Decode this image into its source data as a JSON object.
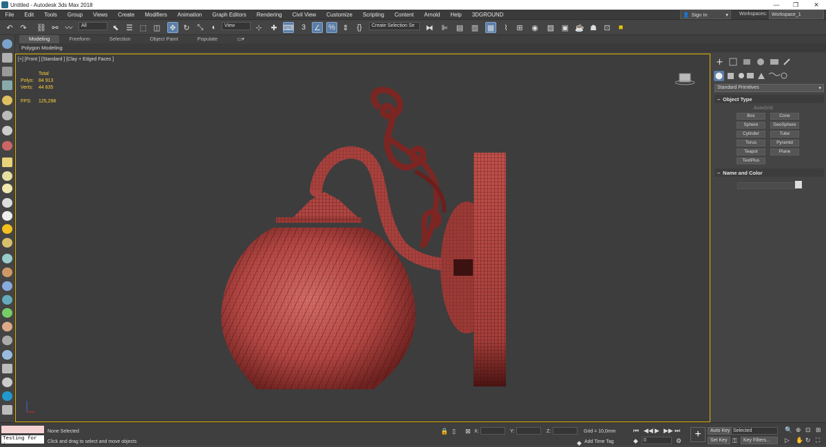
{
  "window": {
    "title": "Untitled - Autodesk 3ds Max 2018"
  },
  "menu": [
    "File",
    "Edit",
    "Tools",
    "Group",
    "Views",
    "Create",
    "Modifiers",
    "Animation",
    "Graph Editors",
    "Rendering",
    "Civil View",
    "Customize",
    "Scripting",
    "Content",
    "Arnold",
    "Help",
    "3DGROUND"
  ],
  "account": {
    "sign_in": "Sign In",
    "workspaces_label": "Workspaces:",
    "workspace": "Workspace_1"
  },
  "toolbar": {
    "filter": "All",
    "refcoord": "View",
    "selection_set": "Create Selection Se"
  },
  "ribbon": {
    "tabs": [
      "Modeling",
      "Freeform",
      "Selection",
      "Object Paint",
      "Populate"
    ],
    "active": "Modeling",
    "sub": "Polygon Modeling"
  },
  "viewport": {
    "label": "[+] [Front ] [Standard ] [Clay + Edged Faces ]",
    "stats": {
      "header": "Total",
      "polys_label": "Polys:",
      "polys": "84 913",
      "verts_label": "Verts:",
      "verts": "44 835",
      "fps_label": "FPS:",
      "fps": "125,298"
    }
  },
  "command_panel": {
    "dropdown": "Standard Primitives",
    "object_type_title": "Object Type",
    "autogrid": "AutoGrid",
    "buttons": [
      "Box",
      "Cone",
      "Sphere",
      "GeoSphere",
      "Cylinder",
      "Tube",
      "Torus",
      "Pyramid",
      "Teapot",
      "Plane",
      "TextPlus"
    ],
    "name_color_title": "Name and Color"
  },
  "status": {
    "maxscript": "Testing for :",
    "selected": "None Selected",
    "prompt": "Click and drag to select and move objects",
    "x_label": "X:",
    "y_label": "Y:",
    "z_label": "Z:",
    "grid": "Grid = 10,0mm",
    "add_time_tag": "Add Time Tag",
    "frame": "0",
    "auto_key": "Auto Key",
    "set_key": "Set Key",
    "key_mode": "Selected",
    "key_filters": "Key Filters..."
  },
  "colors": {
    "model": "#b74a46",
    "wire": "#3a0f0d",
    "viewport_border": "#e5b400",
    "stats": "#ffd23c"
  }
}
